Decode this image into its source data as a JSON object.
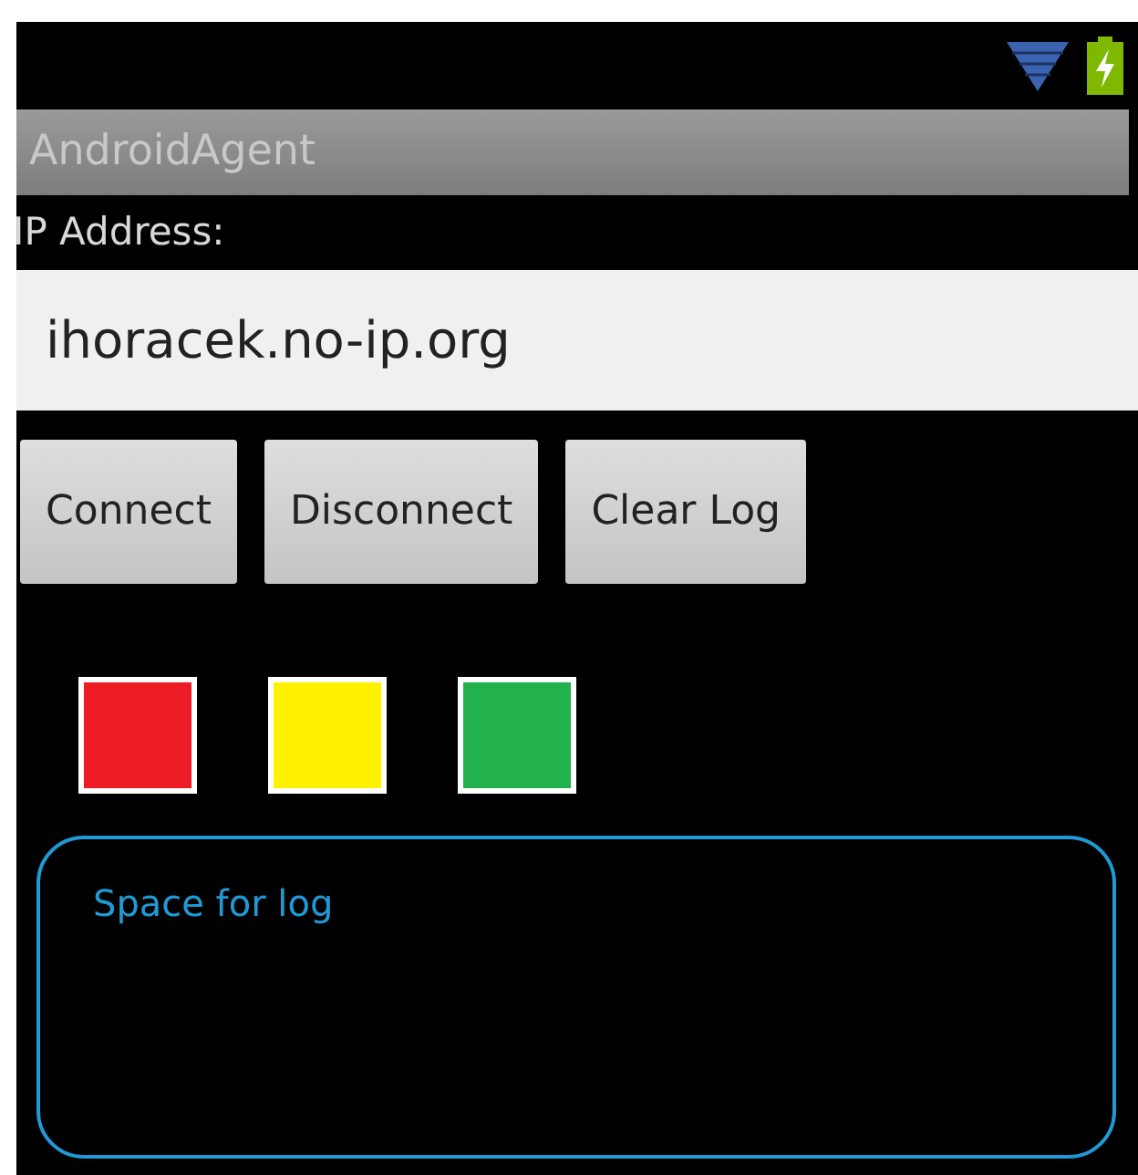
{
  "app_bar": {
    "title": "AndroidAgent"
  },
  "ip_field": {
    "label": "IP Address:",
    "value": "ihoracek.no-ip.org"
  },
  "buttons": [
    "Connect",
    "Disconnect",
    "Clear Log"
  ],
  "indicators": [
    {
      "color": "#ed1c24"
    },
    {
      "color": "#fff200"
    },
    {
      "color": "#22b14c"
    }
  ],
  "log": {
    "text": "Space for log"
  }
}
